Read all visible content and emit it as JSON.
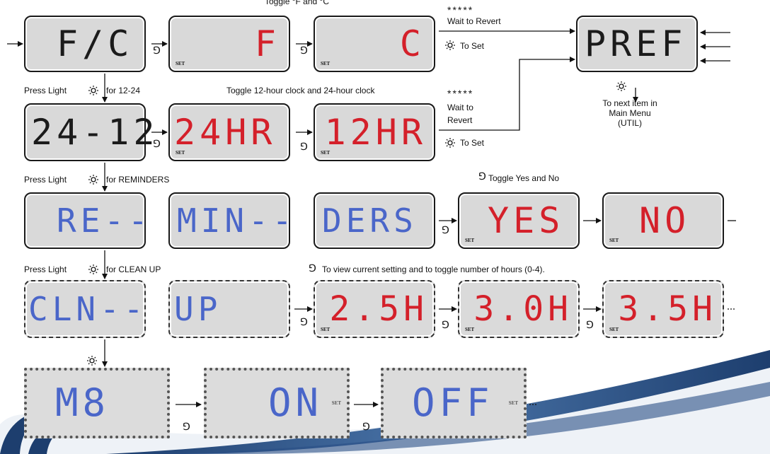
{
  "header": {
    "toggle_f_c": "Toggle °F and °C"
  },
  "row1": {
    "displays": [
      "F/C",
      "F",
      "C"
    ],
    "wait_stars": "*****",
    "wait_label": "Wait to Revert",
    "to_set": "To Set"
  },
  "pref": {
    "display": "PREF",
    "next_item": [
      "To next item in",
      "Main Menu",
      "(UTIL)"
    ]
  },
  "row2": {
    "press_prefix": "Press Light",
    "press_suffix": "for 12-24",
    "toggle_label": "Toggle 12-hour clock and 24-hour clock",
    "displays": [
      "24-12",
      "24HR",
      "12HR"
    ],
    "wait_stars": "*****",
    "wait_label_1": "Wait to",
    "wait_label_2": "Revert",
    "to_set": "To Set"
  },
  "row3": {
    "press_prefix": "Press Light",
    "press_suffix": "for REMINDERS",
    "toggle_label": "Toggle Yes and No",
    "displays": [
      "RE--",
      "MIN--",
      "DERS",
      "YES",
      "NO"
    ]
  },
  "row4": {
    "press_prefix": "Press Light",
    "press_suffix": "for CLEAN UP",
    "toggle_label": "To view current setting and to toggle number of hours (0-4).",
    "displays": [
      "CLN--",
      "UP",
      "2.5H",
      "3.0H",
      "3.5H"
    ]
  },
  "row5": {
    "displays": [
      "M8",
      "ON",
      "OFF"
    ]
  },
  "set_tag": "SET",
  "colors": {
    "lcd_black": "#1b1b1b",
    "lcd_red": "#d4202a",
    "lcd_blue": "#4a66c9",
    "panel_bg": "#d9d9d9",
    "swoosh": "#2a4f85"
  }
}
